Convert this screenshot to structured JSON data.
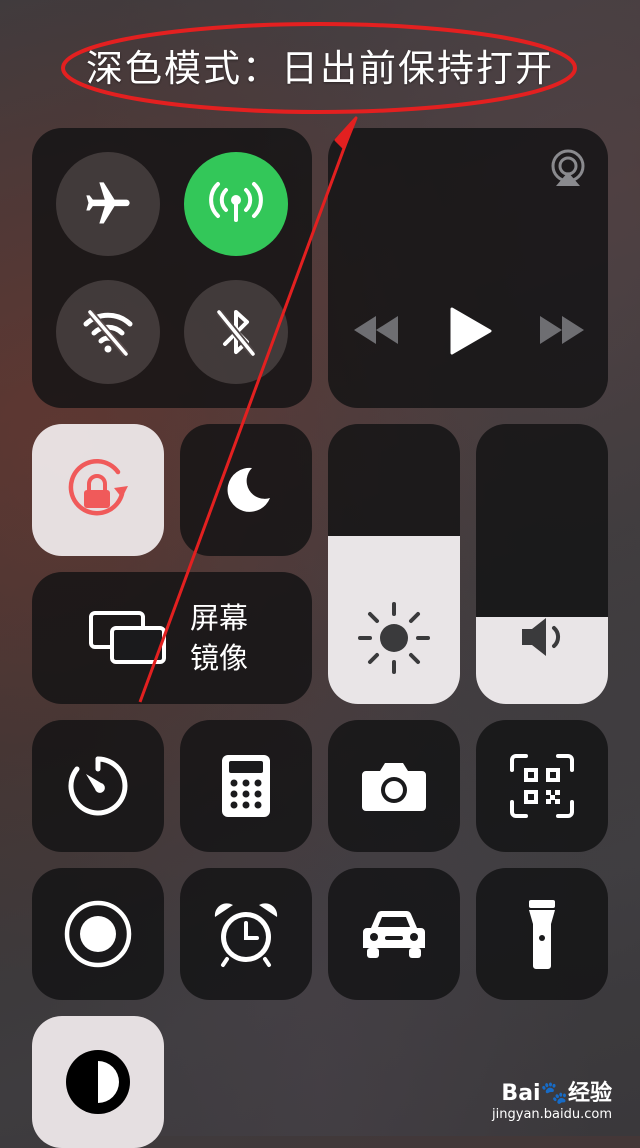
{
  "annotation": {
    "title": "深色模式：日出前保持打开",
    "ellipse_color": "#e32020",
    "arrow_color": "#e32020"
  },
  "connectivity": {
    "airplane": {
      "icon": "airplane-icon",
      "active": false
    },
    "cellular": {
      "icon": "antenna-icon",
      "active": true,
      "color": "#33c759"
    },
    "wifi": {
      "icon": "wifi-off-icon",
      "active": false
    },
    "bluetooth": {
      "icon": "bluetooth-off-icon",
      "active": false
    }
  },
  "media": {
    "airplay_icon": "airplay-icon",
    "controls": [
      "rewind-icon",
      "play-icon",
      "fast-forward-icon"
    ]
  },
  "orientation_lock": {
    "icon": "rotation-lock-icon",
    "active": true,
    "color": "#f05a5a"
  },
  "do_not_disturb": {
    "icon": "moon-icon",
    "active": false
  },
  "screen_mirroring": {
    "label_line1": "屏幕",
    "label_line2": "镜像",
    "icon": "screen-mirror-icon"
  },
  "brightness": {
    "icon": "sun-icon",
    "level": 0.6
  },
  "volume": {
    "icon": "speaker-icon",
    "level": 0.31
  },
  "shortcuts_row1": [
    "timer-icon",
    "calculator-icon",
    "camera-icon",
    "qr-code-icon"
  ],
  "shortcuts_row2": [
    "screen-record-icon",
    "alarm-icon",
    "car-icon",
    "flashlight-icon"
  ],
  "shortcuts_row3": [
    "dark-mode-icon"
  ],
  "watermark": {
    "brand": "Bai",
    "brand2": "经验",
    "url": "jingyan.baidu.com"
  }
}
